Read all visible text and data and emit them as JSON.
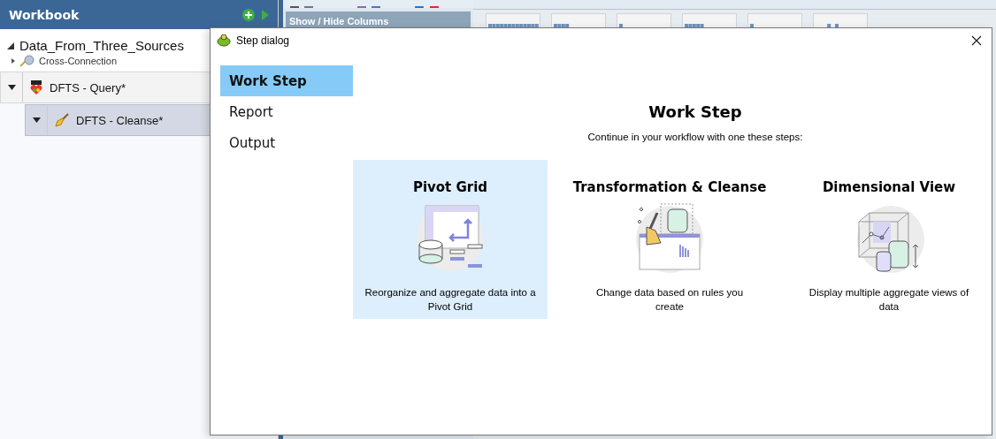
{
  "workbook": {
    "title": "Workbook"
  },
  "tree": {
    "label": "Data_From_Three_Sources",
    "expanded": true,
    "children": [
      {
        "label": "Cross-Connection",
        "expanded": false
      }
    ]
  },
  "steps": [
    {
      "label": "DFTS - Query*",
      "kind": "query",
      "expanded": true,
      "selected": false,
      "children": [
        {
          "label": "DFTS - Cleanse*",
          "kind": "cleanse",
          "expanded": true,
          "selected": true
        }
      ]
    }
  ],
  "columns_panel": {
    "title": "Show / Hide Columns"
  },
  "dialog": {
    "title": "Step dialog",
    "nav": [
      {
        "label": "Work Step",
        "selected": true
      },
      {
        "label": "Report",
        "selected": false
      },
      {
        "label": "Output",
        "selected": false
      }
    ],
    "heading": "Work Step",
    "subtitle": "Continue in your workflow with one these steps:",
    "options": [
      {
        "kind": "pivot",
        "title": "Pivot Grid",
        "description": "Reorganize and aggregate data into a Pivot Grid",
        "selected": true
      },
      {
        "kind": "transform",
        "title": "Transformation & Cleanse",
        "description": "Change data based on rules you create",
        "selected": false
      },
      {
        "kind": "dimensional",
        "title": "Dimensional View",
        "description": "Display multiple aggregate views of data",
        "selected": false
      }
    ]
  }
}
